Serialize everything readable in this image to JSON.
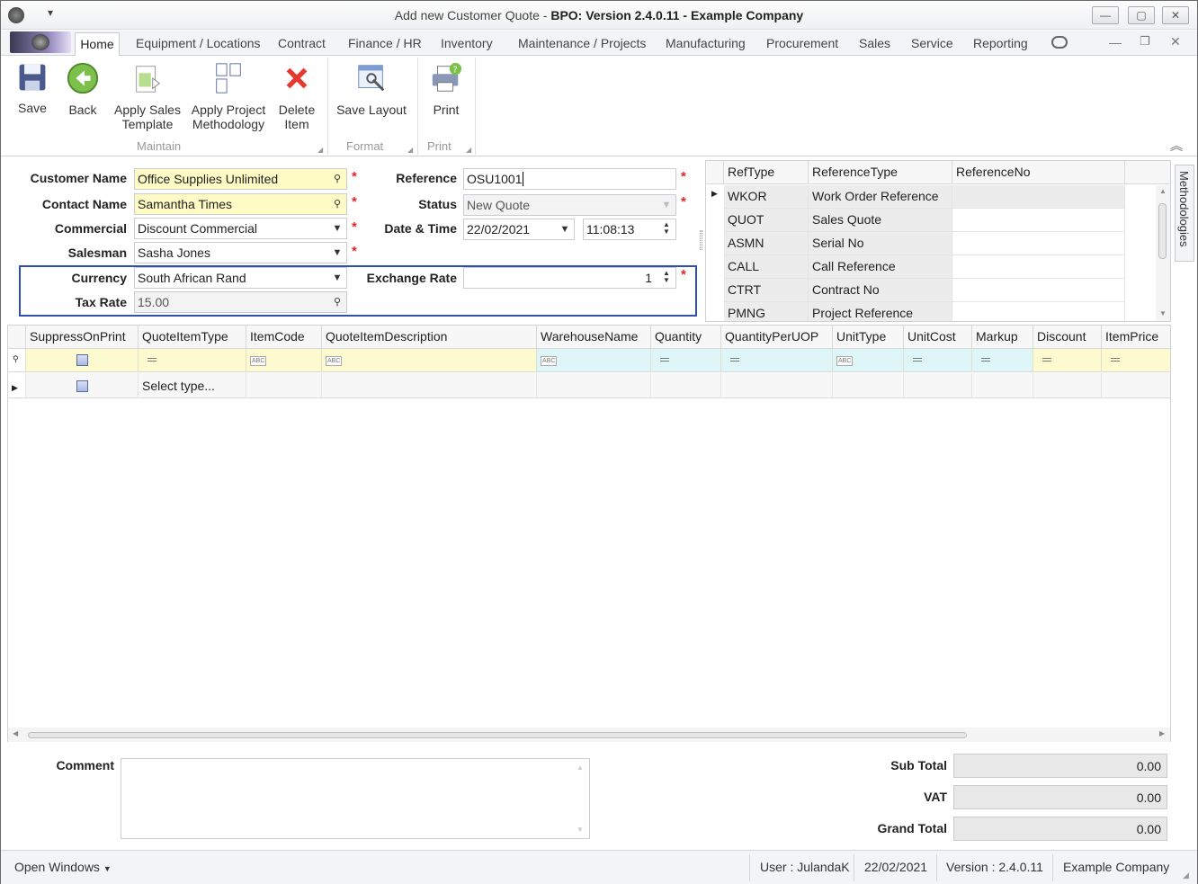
{
  "window": {
    "title_prefix": "Add new Customer Quote",
    "title_main": "BPO: Version 2.4.0.11 - Example Company",
    "title_separator": "-"
  },
  "menu_tabs": [
    "Home",
    "Equipment / Locations",
    "Contract",
    "Finance / HR",
    "Inventory",
    "Maintenance / Projects",
    "Manufacturing",
    "Procurement",
    "Sales",
    "Service",
    "Reporting"
  ],
  "ribbon": {
    "save": "Save",
    "back": "Back",
    "apply_sales_template": [
      "Apply Sales",
      "Template"
    ],
    "apply_project_methodology": [
      "Apply Project",
      "Methodology"
    ],
    "delete_item": [
      "Delete",
      "Item"
    ],
    "save_layout": "Save Layout",
    "print": "Print",
    "groups": {
      "maintain": "Maintain",
      "format": "Format",
      "print": "Print"
    }
  },
  "form": {
    "customer_name_label": "Customer Name",
    "customer_name": "Office Supplies Unlimited",
    "contact_name_label": "Contact Name",
    "contact_name": "Samantha Times",
    "commercial_label": "Commercial",
    "commercial": "Discount Commercial",
    "salesman_label": "Salesman",
    "salesman": "Sasha Jones",
    "currency_label": "Currency",
    "currency": "South African Rand",
    "tax_rate_label": "Tax Rate",
    "tax_rate": "15.00",
    "reference_label": "Reference",
    "reference": "OSU1001",
    "status_label": "Status",
    "status": "New Quote",
    "datetime_label": "Date & Time",
    "date": "22/02/2021",
    "time": "11:08:13",
    "exchange_rate_label": "Exchange Rate",
    "exchange_rate": "1",
    "required_mark": "*"
  },
  "reference_grid": {
    "headers": [
      "RefType",
      "ReferenceType",
      "ReferenceNo"
    ],
    "rows": [
      {
        "reftype": "WKOR",
        "referencetype": "Work Order Reference",
        "referenceno": ""
      },
      {
        "reftype": "QUOT",
        "referencetype": "Sales Quote",
        "referenceno": ""
      },
      {
        "reftype": "ASMN",
        "referencetype": "Serial No",
        "referenceno": ""
      },
      {
        "reftype": "CALL",
        "referencetype": "Call Reference",
        "referenceno": ""
      },
      {
        "reftype": "CTRT",
        "referencetype": "Contract No",
        "referenceno": ""
      },
      {
        "reftype": "PMNG",
        "referencetype": "Project Reference",
        "referenceno": ""
      }
    ]
  },
  "side_tab": "Methodologies",
  "item_grid": {
    "headers": [
      "SuppressOnPrint",
      "QuoteItemType",
      "ItemCode",
      "QuoteItemDescription",
      "WarehouseName",
      "Quantity",
      "QuantityPerUOP",
      "UnitType",
      "UnitCost",
      "Markup",
      "Discount",
      "ItemPrice"
    ],
    "new_row_text": "Select type..."
  },
  "footer": {
    "comment_label": "Comment",
    "subtotal_label": "Sub Total",
    "subtotal": "0.00",
    "vat_label": "VAT",
    "vat": "0.00",
    "grandtotal_label": "Grand Total",
    "grandtotal": "0.00"
  },
  "statusbar": {
    "open_windows": "Open Windows",
    "user": "User : JulandaK",
    "date": "22/02/2021",
    "version": "Version : 2.4.0.11",
    "company": "Example Company"
  },
  "colors": {
    "required": "#e0262b",
    "highlight_border": "#2f4fb5",
    "yellow_field": "#fefbc5"
  }
}
